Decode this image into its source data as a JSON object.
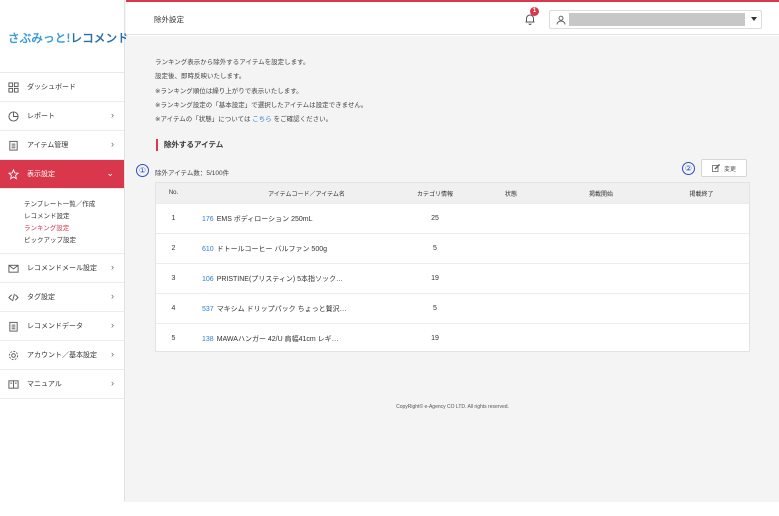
{
  "app": {
    "logo_main": "さぶみっと!",
    "logo_accent": "レコメンド"
  },
  "sidebar": {
    "items": [
      {
        "label": "ダッシュボード",
        "icon": "dashboard-icon",
        "has_chevron": false
      },
      {
        "label": "レポート",
        "icon": "report-icon",
        "has_chevron": true
      },
      {
        "label": "アイテム管理",
        "icon": "item-icon",
        "has_chevron": true
      },
      {
        "label": "表示設定",
        "icon": "star-icon",
        "has_chevron": true,
        "active": true
      },
      {
        "label": "レコメンドメール設定",
        "icon": "mail-icon",
        "has_chevron": true
      },
      {
        "label": "タグ設定",
        "icon": "code-icon",
        "has_chevron": true
      },
      {
        "label": "レコメンドデータ",
        "icon": "data-icon",
        "has_chevron": true
      },
      {
        "label": "アカウント／基本設定",
        "icon": "gear-icon",
        "has_chevron": true
      },
      {
        "label": "マニュアル",
        "icon": "book-icon",
        "has_chevron": true
      }
    ],
    "subitems": [
      "テンプレート一覧／作成",
      "レコメンド設定",
      "ランキング設定",
      "ピックアップ設定"
    ],
    "current_subitem": "ランキング設定"
  },
  "header": {
    "title": "除外設定",
    "notification_count": "1"
  },
  "intro": {
    "line1": "ランキング表示から除外するアイテムを設定します。",
    "line2": "設定後、即時反映いたします。",
    "line3": "※ランキング順位は繰り上がりで表示いたします。",
    "line4": "※ランキング設定の「基本設定」で選択したアイテムは設定できません。",
    "line5_before": "※アイテムの「状態」については",
    "line5_link": "こちら",
    "line5_after": "をご確認ください。"
  },
  "section": {
    "title": "除外するアイテム",
    "mark1": "①",
    "mark2": "②",
    "count_text": "除外アイテム数：5/100件",
    "edit_label": "変更"
  },
  "table": {
    "headers": {
      "no": "No.",
      "name": "アイテムコード／アイテム名",
      "category": "カテゴリ情報",
      "status": "状態",
      "start": "掲載開始",
      "end": "掲載終了"
    },
    "rows": [
      {
        "no": "1",
        "code": "176",
        "name": "EMS ボディローション 250mL",
        "category": "25",
        "status": "",
        "start": "",
        "end": ""
      },
      {
        "no": "2",
        "code": "610",
        "name": "ドトールコーヒー バルファン 500g",
        "category": "5",
        "status": "",
        "start": "",
        "end": ""
      },
      {
        "no": "3",
        "code": "106",
        "name": "PRISTINE(プリスティン) 5本指ソック…",
        "category": "19",
        "status": "",
        "start": "",
        "end": ""
      },
      {
        "no": "4",
        "code": "537",
        "name": "マキシム ドリップパック ちょっと贅沢…",
        "category": "5",
        "status": "",
        "start": "",
        "end": ""
      },
      {
        "no": "5",
        "code": "138",
        "name": "MAWAハンガー 42/U 肩幅41cm レギ…",
        "category": "19",
        "status": "",
        "start": "",
        "end": ""
      }
    ]
  },
  "footer": {
    "copyright": "CopyRight© e-Agency CO LTD. All rights reserved."
  },
  "colors": {
    "accent": "#d9374b",
    "link": "#2f7bd6",
    "annotation": "#2a4fc9",
    "logo": "#3a9bd9"
  }
}
